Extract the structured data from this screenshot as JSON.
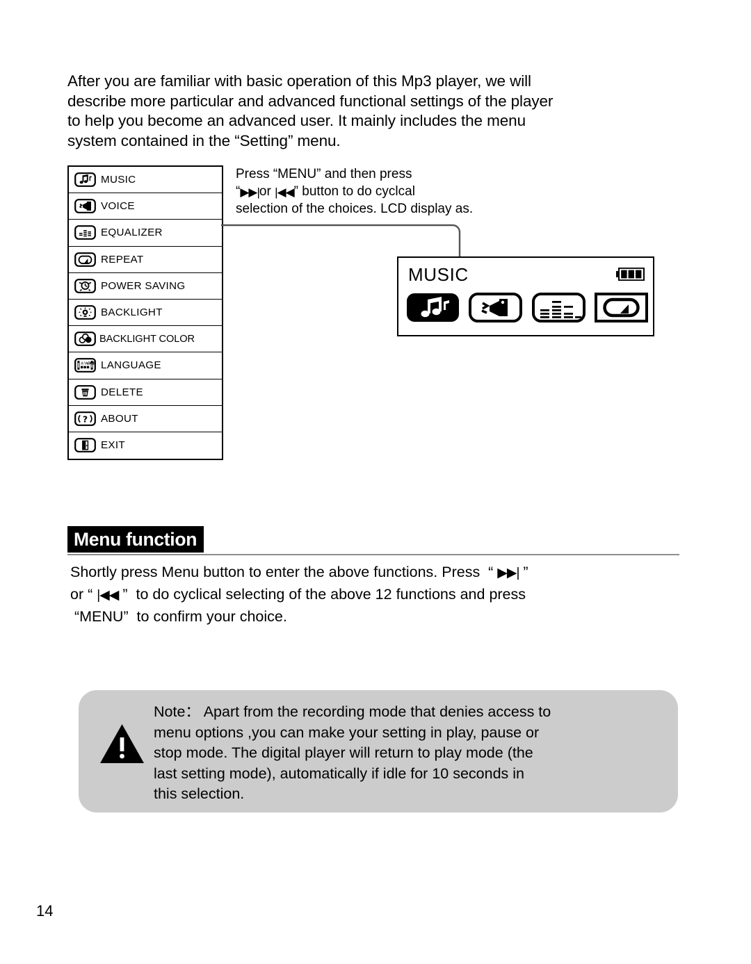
{
  "page": {
    "number": "14",
    "intro_paragraph": "After you are familiar with basic operation of this Mp3 player, we will\ndescribe more particular and advanced functional settings of the player\nto help you become an advanced user. It mainly includes the menu\nsystem contained in the “Setting” menu."
  },
  "menu_table": {
    "items": [
      {
        "icon": "music-note-icon",
        "label": "MUSIC"
      },
      {
        "icon": "voice-record-icon",
        "label": "VOICE"
      },
      {
        "icon": "equalizer-icon",
        "label": "EQUALIZER"
      },
      {
        "icon": "repeat-loop-icon",
        "label": "REPEAT"
      },
      {
        "icon": "power-saving-clock-icon",
        "label": "POWER SAVING"
      },
      {
        "icon": "backlight-bulb-icon",
        "label": "BACKLIGHT"
      },
      {
        "icon": "backlight-color-icon",
        "label": "BACKLIGHT COLOR"
      },
      {
        "icon": "language-flag-icon",
        "label": "LANGUAGE"
      },
      {
        "icon": "delete-trash-icon",
        "label": "DELETE"
      },
      {
        "icon": "about-question-icon",
        "label": "ABOUT"
      },
      {
        "icon": "exit-door-icon",
        "label": "EXIT"
      }
    ]
  },
  "callout": {
    "line1_a": "Press ",
    "line1_b": "“MENU”",
    "line1_c": " and then press",
    "line2_a": "“",
    "line2_fwd": "▶▶|",
    "line2_b": "or ",
    "line2_rev": "|◀◀",
    "line2_c": "” button to do cyclcal",
    "line3": "selection of the choices. LCD display as."
  },
  "lcd": {
    "title": "MUSIC",
    "battery_bars": 3,
    "icons": [
      {
        "name": "music-note-icon",
        "selected": true
      },
      {
        "name": "voice-record-icon",
        "selected": false
      },
      {
        "name": "equalizer-icon",
        "selected": false
      },
      {
        "name": "repeat-loop-icon",
        "selected": false
      }
    ]
  },
  "section": {
    "heading": "Menu function",
    "body_a": "Shortly press Menu button to enter the above functions. Press  “ ",
    "body_fwd": "▶▶|",
    "body_b": " ”\nor “ ",
    "body_rev": "|◀◀",
    "body_c": " ”  to do cyclical selecting of the above 12 functions and press\n “MENU”  to confirm your choice."
  },
  "note": {
    "icon": "warning-triangle-icon",
    "text": "Note： Apart from the recording mode that denies access to\nmenu options ,you can make your setting in play, pause or\nstop mode. The digital player will return to play mode (the\nlast setting mode), automatically if idle for 10 seconds in\nthis selection."
  },
  "colors": {
    "ink": "#000000",
    "paper": "#ffffff",
    "note_bg": "#cccccc",
    "rule": "#8d8d8d"
  }
}
